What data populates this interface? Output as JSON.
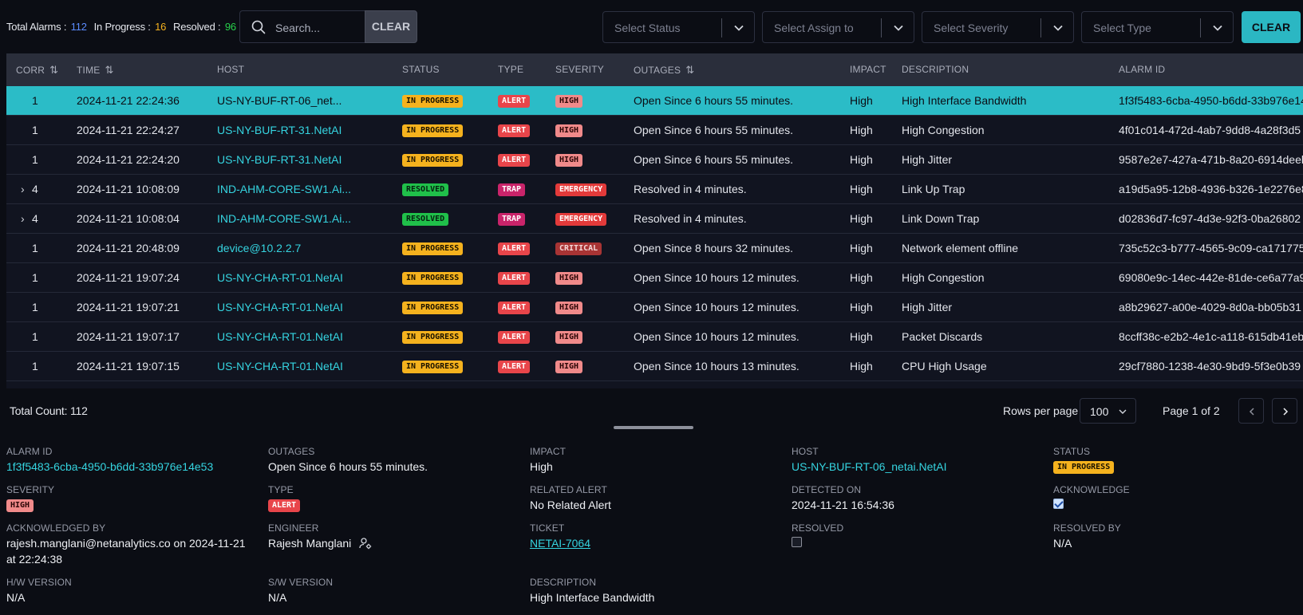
{
  "summary": {
    "total_label": "Total Alarms : ",
    "total": "112",
    "progress_label": "In Progress : ",
    "progress": "16",
    "resolved_label": "Resolved : ",
    "resolved": "96"
  },
  "search": {
    "placeholder": "Search...",
    "clear": "CLEAR"
  },
  "filters": {
    "status": "Select Status",
    "assign": "Select Assign to",
    "severity": "Select Severity",
    "type": "Select Type",
    "clear": "CLEAR"
  },
  "columns": {
    "corr": "CORR",
    "time": "TIME",
    "host": "HOST",
    "status": "STATUS",
    "type": "TYPE",
    "severity": "SEVERITY",
    "outages": "OUTAGES",
    "impact": "IMPACT",
    "description": "DESCRIPTION",
    "alarm_id": "ALARM ID"
  },
  "rows": [
    {
      "corr": "1",
      "time": "2024-11-21 22:24:36",
      "host": "US-NY-BUF-RT-06_net...",
      "status": "IN PROGRESS",
      "type": "ALERT",
      "severity": "HIGH",
      "outages": "Open Since 6 hours 55 minutes.",
      "impact": "High",
      "description": "High Interface Bandwidth",
      "alarm_id": "1f3f5483-6cba-4950-b6dd-33b976e14e53"
    },
    {
      "corr": "1",
      "time": "2024-11-21 22:24:27",
      "host": "US-NY-BUF-RT-31.NetAI",
      "status": "IN PROGRESS",
      "type": "ALERT",
      "severity": "HIGH",
      "outages": "Open Since 6 hours 55 minutes.",
      "impact": "High",
      "description": "High Congestion",
      "alarm_id": "4f01c014-472d-4ab7-9dd8-4a28f3d5"
    },
    {
      "corr": "1",
      "time": "2024-11-21 22:24:20",
      "host": "US-NY-BUF-RT-31.NetAI",
      "status": "IN PROGRESS",
      "type": "ALERT",
      "severity": "HIGH",
      "outages": "Open Since 6 hours 55 minutes.",
      "impact": "High",
      "description": "High Jitter",
      "alarm_id": "9587e2e7-427a-471b-8a20-6914deeb"
    },
    {
      "corr": "4",
      "time": "2024-11-21 10:08:09",
      "host": "IND-AHM-CORE-SW1.Ai...",
      "status": "RESOLVED",
      "type": "TRAP",
      "severity": "EMERGENCY",
      "outages": "Resolved in 4 minutes.",
      "impact": "High",
      "description": "Link Up Trap",
      "alarm_id": "a19d5a95-12b8-4936-b326-1e2276e8"
    },
    {
      "corr": "4",
      "time": "2024-11-21 10:08:04",
      "host": "IND-AHM-CORE-SW1.Ai...",
      "status": "RESOLVED",
      "type": "TRAP",
      "severity": "EMERGENCY",
      "outages": "Resolved in 4 minutes.",
      "impact": "High",
      "description": "Link Down Trap",
      "alarm_id": "d02836d7-fc97-4d3e-92f3-0ba26802"
    },
    {
      "corr": "1",
      "time": "2024-11-21 20:48:09",
      "host": "device@10.2.2.7",
      "status": "IN PROGRESS",
      "type": "ALERT",
      "severity": "CRITICAL",
      "outages": "Open Since 8 hours 32 minutes.",
      "impact": "High",
      "description": "Network element offline",
      "alarm_id": "735c52c3-b777-4565-9c09-ca171775"
    },
    {
      "corr": "1",
      "time": "2024-11-21 19:07:24",
      "host": "US-NY-CHA-RT-01.NetAI",
      "status": "IN PROGRESS",
      "type": "ALERT",
      "severity": "HIGH",
      "outages": "Open Since 10 hours 12 minutes.",
      "impact": "High",
      "description": "High Congestion",
      "alarm_id": "69080e9c-14ec-442e-81de-ce6a77a9"
    },
    {
      "corr": "1",
      "time": "2024-11-21 19:07:21",
      "host": "US-NY-CHA-RT-01.NetAI",
      "status": "IN PROGRESS",
      "type": "ALERT",
      "severity": "HIGH",
      "outages": "Open Since 10 hours 12 minutes.",
      "impact": "High",
      "description": "High Jitter",
      "alarm_id": "a8b29627-a00e-4029-8d0a-bb05b31"
    },
    {
      "corr": "1",
      "time": "2024-11-21 19:07:17",
      "host": "US-NY-CHA-RT-01.NetAI",
      "status": "IN PROGRESS",
      "type": "ALERT",
      "severity": "HIGH",
      "outages": "Open Since 10 hours 12 minutes.",
      "impact": "High",
      "description": "Packet Discards",
      "alarm_id": "8ccff38c-e2b2-4e1c-a118-615db41eb4"
    },
    {
      "corr": "1",
      "time": "2024-11-21 19:07:15",
      "host": "US-NY-CHA-RT-01.NetAI",
      "status": "IN PROGRESS",
      "type": "ALERT",
      "severity": "HIGH",
      "outages": "Open Since 10 hours 13 minutes.",
      "impact": "High",
      "description": "CPU High Usage",
      "alarm_id": "29cf7880-1238-4e30-9bd9-5f3e0b39"
    }
  ],
  "footer": {
    "total_count": "Total Count: 112",
    "rows_per_page_label": "Rows per page",
    "rows_per_page": "100",
    "page_info": "Page 1 of 2"
  },
  "details": {
    "alarm_id": {
      "label": "ALARM ID",
      "value": "1f3f5483-6cba-4950-b6dd-33b976e14e53"
    },
    "outages": {
      "label": "OUTAGES",
      "value": "Open Since 6 hours 55 minutes."
    },
    "impact": {
      "label": "IMPACT",
      "value": "High"
    },
    "host": {
      "label": "HOST",
      "value": "US-NY-BUF-RT-06_netai.NetAI"
    },
    "status": {
      "label": "STATUS",
      "value": "IN PROGRESS"
    },
    "severity": {
      "label": "SEVERITY",
      "value": "HIGH"
    },
    "type": {
      "label": "TYPE",
      "value": "ALERT"
    },
    "related_alert": {
      "label": "RELATED ALERT",
      "value": "No Related Alert"
    },
    "detected_on": {
      "label": "DETECTED ON",
      "value": "2024-11-21 16:54:36"
    },
    "acknowledge": {
      "label": "ACKNOWLEDGE",
      "checked": true
    },
    "acknowledged_by": {
      "label": "ACKNOWLEDGED BY",
      "value": "rajesh.manglani@netanalytics.co on 2024-11-21 at 22:24:38"
    },
    "engineer": {
      "label": "ENGINEER",
      "value": "Rajesh Manglani"
    },
    "ticket": {
      "label": "TICKET",
      "value": "NETAI-7064"
    },
    "resolved": {
      "label": "RESOLVED",
      "checked": false
    },
    "resolved_by": {
      "label": "RESOLVED BY",
      "value": "N/A"
    },
    "hw_version": {
      "label": "H/W VERSION",
      "value": "N/A"
    },
    "sw_version": {
      "label": "S/W VERSION",
      "value": "N/A"
    },
    "description": {
      "label": "DESCRIPTION",
      "value": "High Interface Bandwidth"
    }
  },
  "colors": {
    "accent": "#2bb7c3",
    "in_progress": "#f5b21e",
    "resolved": "#20c04a",
    "alert": "#e8454a",
    "trap": "#c9246a",
    "high": "#f08a8a",
    "emergency": "#e33a3a",
    "critical": "#a83434"
  },
  "selected_row": 0
}
